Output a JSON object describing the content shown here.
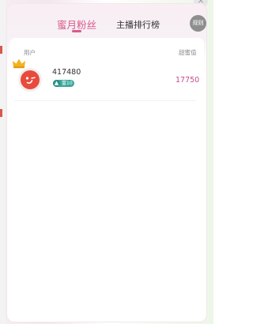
{
  "tabs": {
    "fans_label": "蜜月粉丝",
    "rank_label": "主播排行榜"
  },
  "rules_button": "规则",
  "close_glyph": "×",
  "table": {
    "col_user": "用户",
    "col_sweet": "甜蜜值",
    "rows": [
      {
        "name": "417480",
        "level": "富10",
        "sweet": "17750"
      }
    ]
  },
  "colors": {
    "accent_pink": "#d95a8c",
    "value_pink": "#c24e8a",
    "badge_teal": "#3aa89a",
    "avatar_red": "#e84a3b",
    "crown_gold": "#f2b322"
  },
  "icons": {
    "crown": "crown-icon",
    "level": "level-icon",
    "close": "close-icon"
  }
}
